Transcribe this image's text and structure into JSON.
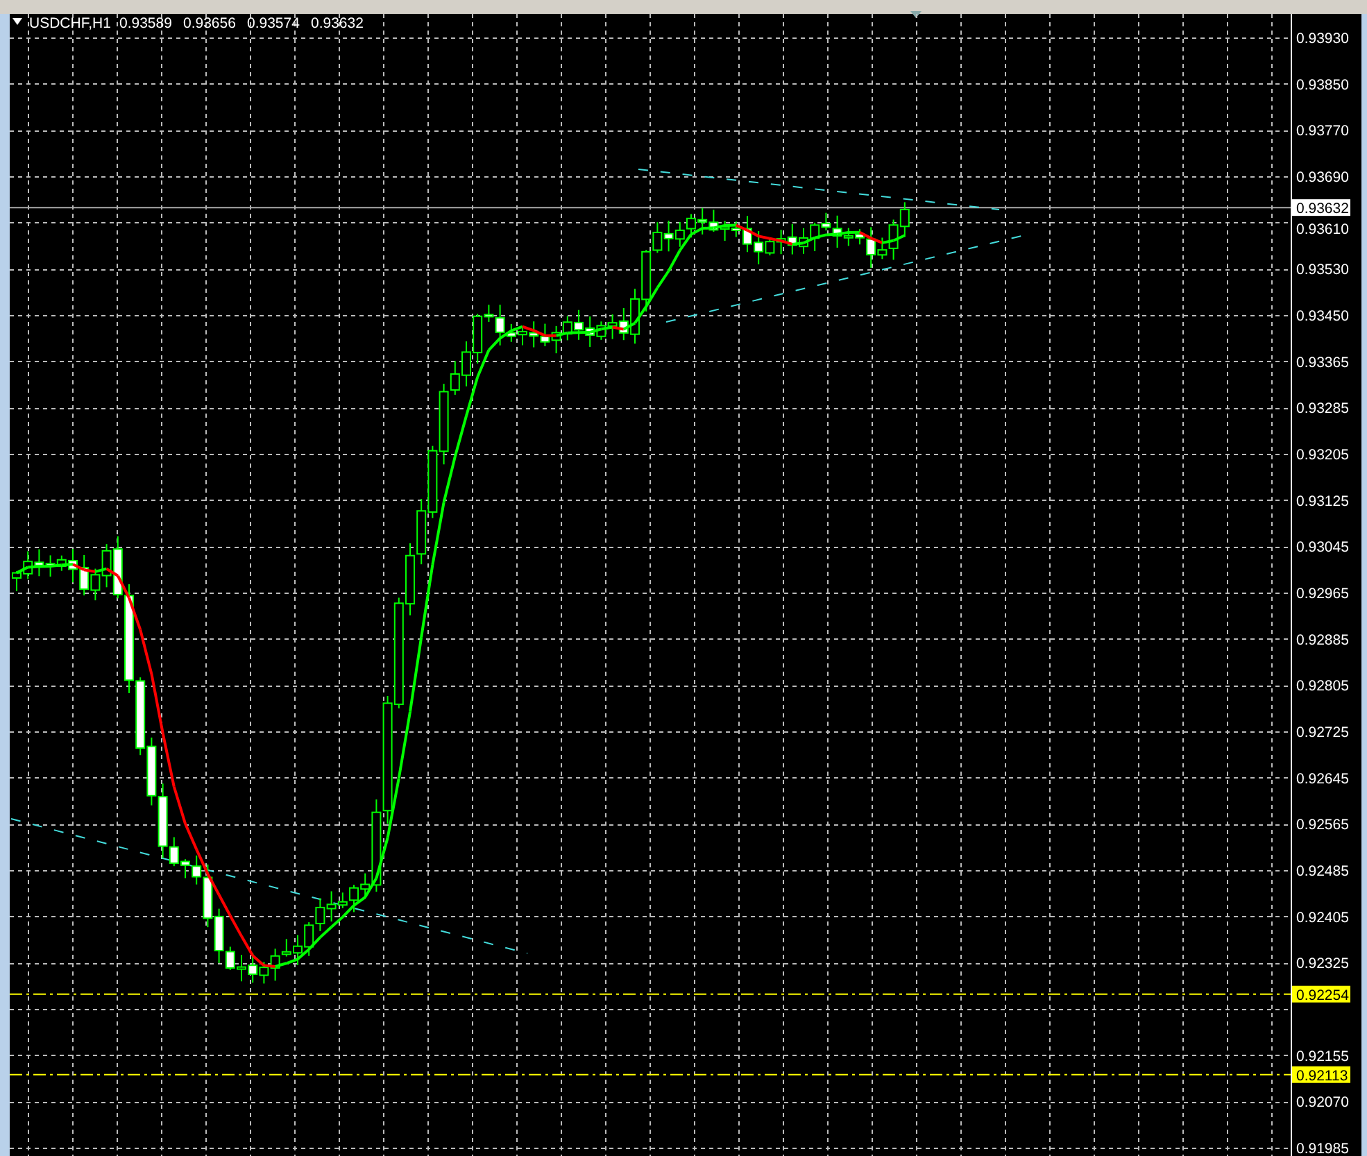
{
  "chart": {
    "symbol_label": "USDCHF,H1",
    "ohlc": [
      "0.93589",
      "0.93656",
      "0.93574",
      "0.93632"
    ],
    "price_axis": [
      "0.93930",
      "0.93850",
      "0.93770",
      "0.93690",
      "0.93610",
      "0.93530",
      "0.93450",
      "0.93365",
      "0.93285",
      "0.93205",
      "0.93125",
      "0.93045",
      "0.92965",
      "0.92885",
      "0.92805",
      "0.92725",
      "0.92645",
      "0.92565",
      "0.92485",
      "0.92405",
      "0.92325",
      "0.92155",
      "0.92070",
      "0.91985"
    ],
    "price_tags": [
      {
        "text": "0.93632",
        "kind": "bid"
      },
      {
        "text": "0.92254",
        "kind": "level"
      },
      {
        "text": "0.92113",
        "kind": "level"
      }
    ]
  }
}
